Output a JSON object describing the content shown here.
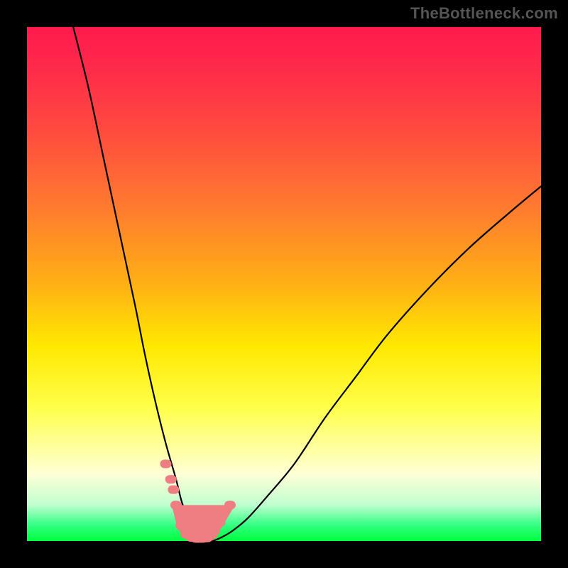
{
  "watermark": "TheBottleneck.com",
  "chart_data": {
    "type": "line",
    "title": "",
    "xlabel": "",
    "ylabel": "",
    "xlim": [
      0,
      100
    ],
    "ylim": [
      0,
      100
    ],
    "grid": false,
    "series": [
      {
        "name": "bottleneck-curve",
        "x": [
          9,
          12,
          15,
          18,
          21,
          23,
          25,
          27,
          29,
          30,
          31,
          32,
          33,
          34,
          36,
          38,
          40,
          43,
          47,
          52,
          58,
          64,
          70,
          78,
          86,
          94,
          100
        ],
        "y": [
          100,
          88,
          74,
          60,
          46,
          36,
          27,
          19,
          12,
          8,
          5,
          2,
          0.5,
          0,
          0,
          0.8,
          2,
          4.5,
          9,
          15,
          24,
          32,
          40,
          49,
          57,
          64,
          69
        ]
      }
    ],
    "highlight_points": {
      "name": "red-dots-near-minimum",
      "x": [
        27,
        28,
        28.5,
        29,
        30,
        31,
        32,
        33,
        34,
        35,
        35.5,
        36,
        36.5,
        37.5,
        39.5
      ],
      "y": [
        15,
        12,
        10,
        7,
        3,
        1.3,
        0.7,
        0.5,
        0.5,
        0.6,
        0.9,
        1.3,
        2.0,
        3.6,
        7.0
      ]
    },
    "background_gradient": {
      "orientation": "vertical",
      "stops": [
        {
          "pos": 0.0,
          "color": "#ff1a4d"
        },
        {
          "pos": 0.35,
          "color": "#ff7a2f"
        },
        {
          "pos": 0.62,
          "color": "#ffe800"
        },
        {
          "pos": 0.87,
          "color": "#ffffd6"
        },
        {
          "pos": 1.0,
          "color": "#00ff3c"
        }
      ]
    }
  }
}
